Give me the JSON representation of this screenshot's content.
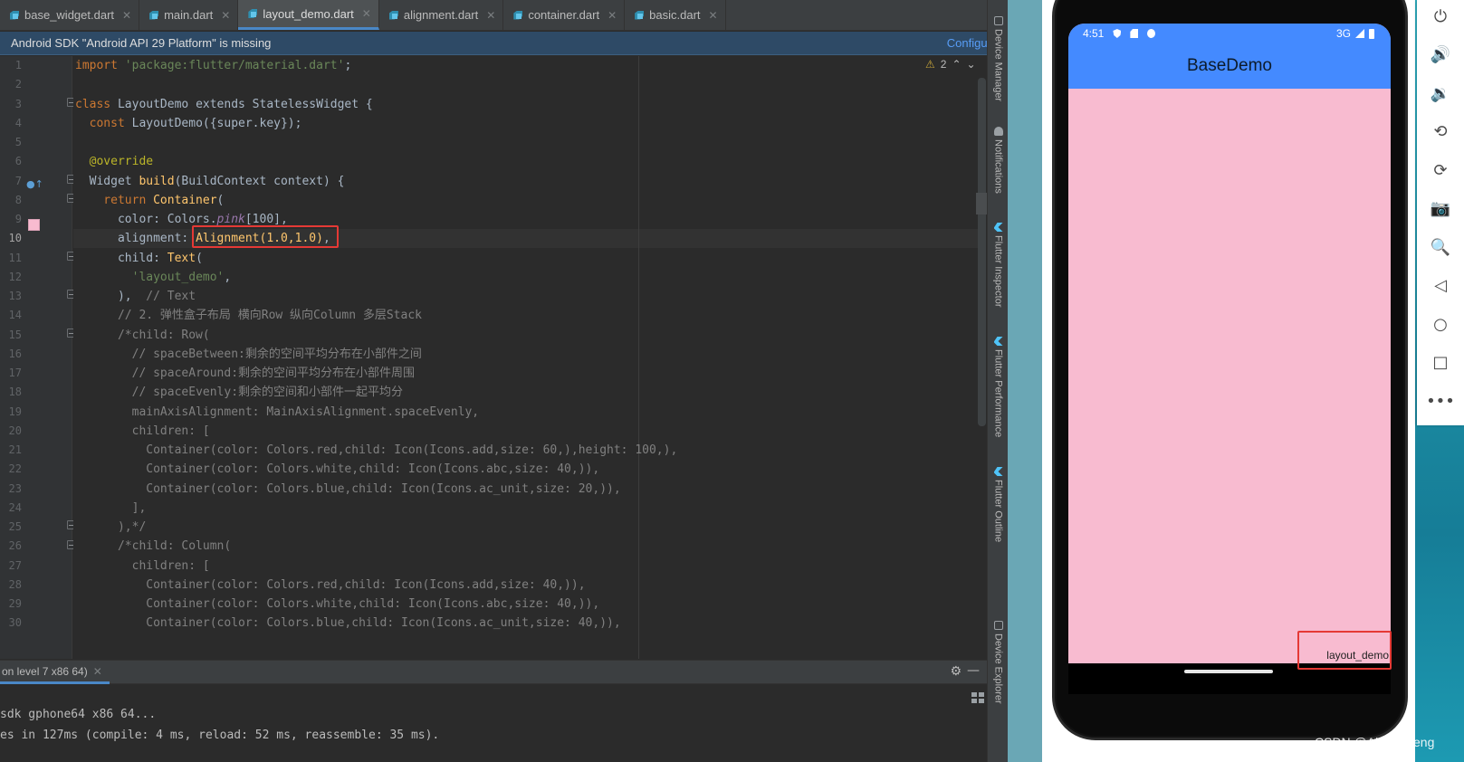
{
  "tabs": [
    {
      "label": "base_widget.dart",
      "active": false
    },
    {
      "label": "main.dart",
      "active": false
    },
    {
      "label": "layout_demo.dart",
      "active": true
    },
    {
      "label": "alignment.dart",
      "active": false
    },
    {
      "label": "container.dart",
      "active": false
    },
    {
      "label": "basic.dart",
      "active": false
    }
  ],
  "banner": {
    "text": "Android SDK \"Android API 29 Platform\" is missing",
    "link": "Configure..."
  },
  "inspection": {
    "warning_count": "2"
  },
  "editor": {
    "current_line": 10,
    "line_numbers": [
      "1",
      "2",
      "3",
      "4",
      "5",
      "6",
      "7",
      "8",
      "9",
      "10",
      "11",
      "12",
      "13",
      "14",
      "15",
      "16",
      "17",
      "18",
      "19",
      "20",
      "21",
      "22",
      "23",
      "24",
      "25",
      "26",
      "27",
      "28",
      "29",
      "30"
    ],
    "lines": [
      {
        "p": "import ",
        "s": "'package:flutter/material.dart'",
        "e": ";"
      },
      {
        "p": "",
        "s": "",
        "e": ""
      },
      {
        "p": "class ",
        "s": "LayoutDemo ",
        "e": "extends StatelessWidget {"
      },
      {
        "p": "  const ",
        "s": "LayoutDemo({super.key})",
        "e": ";"
      },
      {
        "p": "",
        "s": "",
        "e": ""
      },
      {
        "p": "  ",
        "s": "@override",
        "e": ""
      },
      {
        "p": "  Widget ",
        "s": "build",
        "e": "(BuildContext context) {"
      },
      {
        "p": "    return ",
        "s": "Container",
        "e": "("
      },
      {
        "p": "      color: Colors.",
        "s": "pink",
        "e": "[100],"
      },
      {
        "p": "      alignment: ",
        "s": "Alignment(1.0,1.0)",
        "e": ","
      },
      {
        "p": "      child: ",
        "s": "Text",
        "e": "("
      },
      {
        "p": "        ",
        "s": "'layout_demo'",
        "e": ","
      },
      {
        "p": "      ),  ",
        "s": "// Text",
        "e": ""
      },
      {
        "p": "      ",
        "s": "// 2. 弹性盒子布局 横向Row 纵向Column 多层Stack",
        "e": ""
      },
      {
        "p": "      ",
        "s": "/*child: Row(",
        "e": ""
      },
      {
        "p": "        ",
        "s": "// spaceBetween:剩余的空间平均分布在小部件之间",
        "e": ""
      },
      {
        "p": "        ",
        "s": "// spaceAround:剩余的空间平均分布在小部件周围",
        "e": ""
      },
      {
        "p": "        ",
        "s": "// spaceEvenly:剩余的空间和小部件一起平均分",
        "e": ""
      },
      {
        "p": "        ",
        "s": "mainAxisAlignment: MainAxisAlignment.spaceEvenly,",
        "e": ""
      },
      {
        "p": "        ",
        "s": "children: [",
        "e": ""
      },
      {
        "p": "          ",
        "s": "Container(color: Colors.red,child: Icon(Icons.add,size: 60,),height: 100,),",
        "e": ""
      },
      {
        "p": "          ",
        "s": "Container(color: Colors.white,child: Icon(Icons.abc,size: 40,)),",
        "e": ""
      },
      {
        "p": "          ",
        "s": "Container(color: Colors.blue,child: Icon(Icons.ac_unit,size: 20,)),",
        "e": ""
      },
      {
        "p": "        ",
        "s": "],",
        "e": ""
      },
      {
        "p": "      ",
        "s": "),*/",
        "e": ""
      },
      {
        "p": "      ",
        "s": "/*child: Column(",
        "e": ""
      },
      {
        "p": "        ",
        "s": "children: [",
        "e": ""
      },
      {
        "p": "          ",
        "s": "Container(color: Colors.red,child: Icon(Icons.add,size: 40,)),",
        "e": ""
      },
      {
        "p": "          ",
        "s": "Container(color: Colors.white,child: Icon(Icons.abc,size: 40,)),",
        "e": ""
      },
      {
        "p": "          ",
        "s": "Container(color: Colors.blue,child: Icon(Icons.ac_unit,size: 40,)),",
        "e": ""
      }
    ]
  },
  "tool_windows": [
    {
      "label": "Device Manager"
    },
    {
      "label": "Notifications"
    },
    {
      "label": "Flutter Inspector"
    },
    {
      "label": "Flutter Performance"
    },
    {
      "label": "Flutter Outline"
    },
    {
      "label": "Device Explorer"
    }
  ],
  "run_panel": {
    "tab_label": "on level 7 x86 64)",
    "lines": [
      "sdk gphone64 x86 64...",
      "es in 127ms (compile: 4 ms, reload: 52 ms, reassemble: 35 ms)."
    ]
  },
  "phone": {
    "time": "4:51",
    "network": "3G",
    "app_title": "BaseDemo",
    "demo_text": "layout_demo",
    "colors": {
      "appbar": "#448aff",
      "body": "#f8bbd0"
    }
  },
  "emulator_controls": [
    {
      "icon": "power-icon",
      "glyph": "⏻"
    },
    {
      "icon": "volume-up-icon",
      "glyph": "🔊"
    },
    {
      "icon": "volume-down-icon",
      "glyph": "🔉"
    },
    {
      "icon": "rotate-left-icon",
      "glyph": "⟲"
    },
    {
      "icon": "rotate-right-icon",
      "glyph": "⟳"
    },
    {
      "icon": "camera-icon",
      "glyph": "📷"
    },
    {
      "icon": "zoom-icon",
      "glyph": "🔍"
    },
    {
      "icon": "back-icon",
      "glyph": "◁"
    },
    {
      "icon": "home-icon",
      "glyph": "○"
    },
    {
      "icon": "overview-icon",
      "glyph": "□"
    },
    {
      "icon": "more-icon",
      "glyph": "•••"
    }
  ],
  "watermark": "CSDN @Alice◆Deng"
}
